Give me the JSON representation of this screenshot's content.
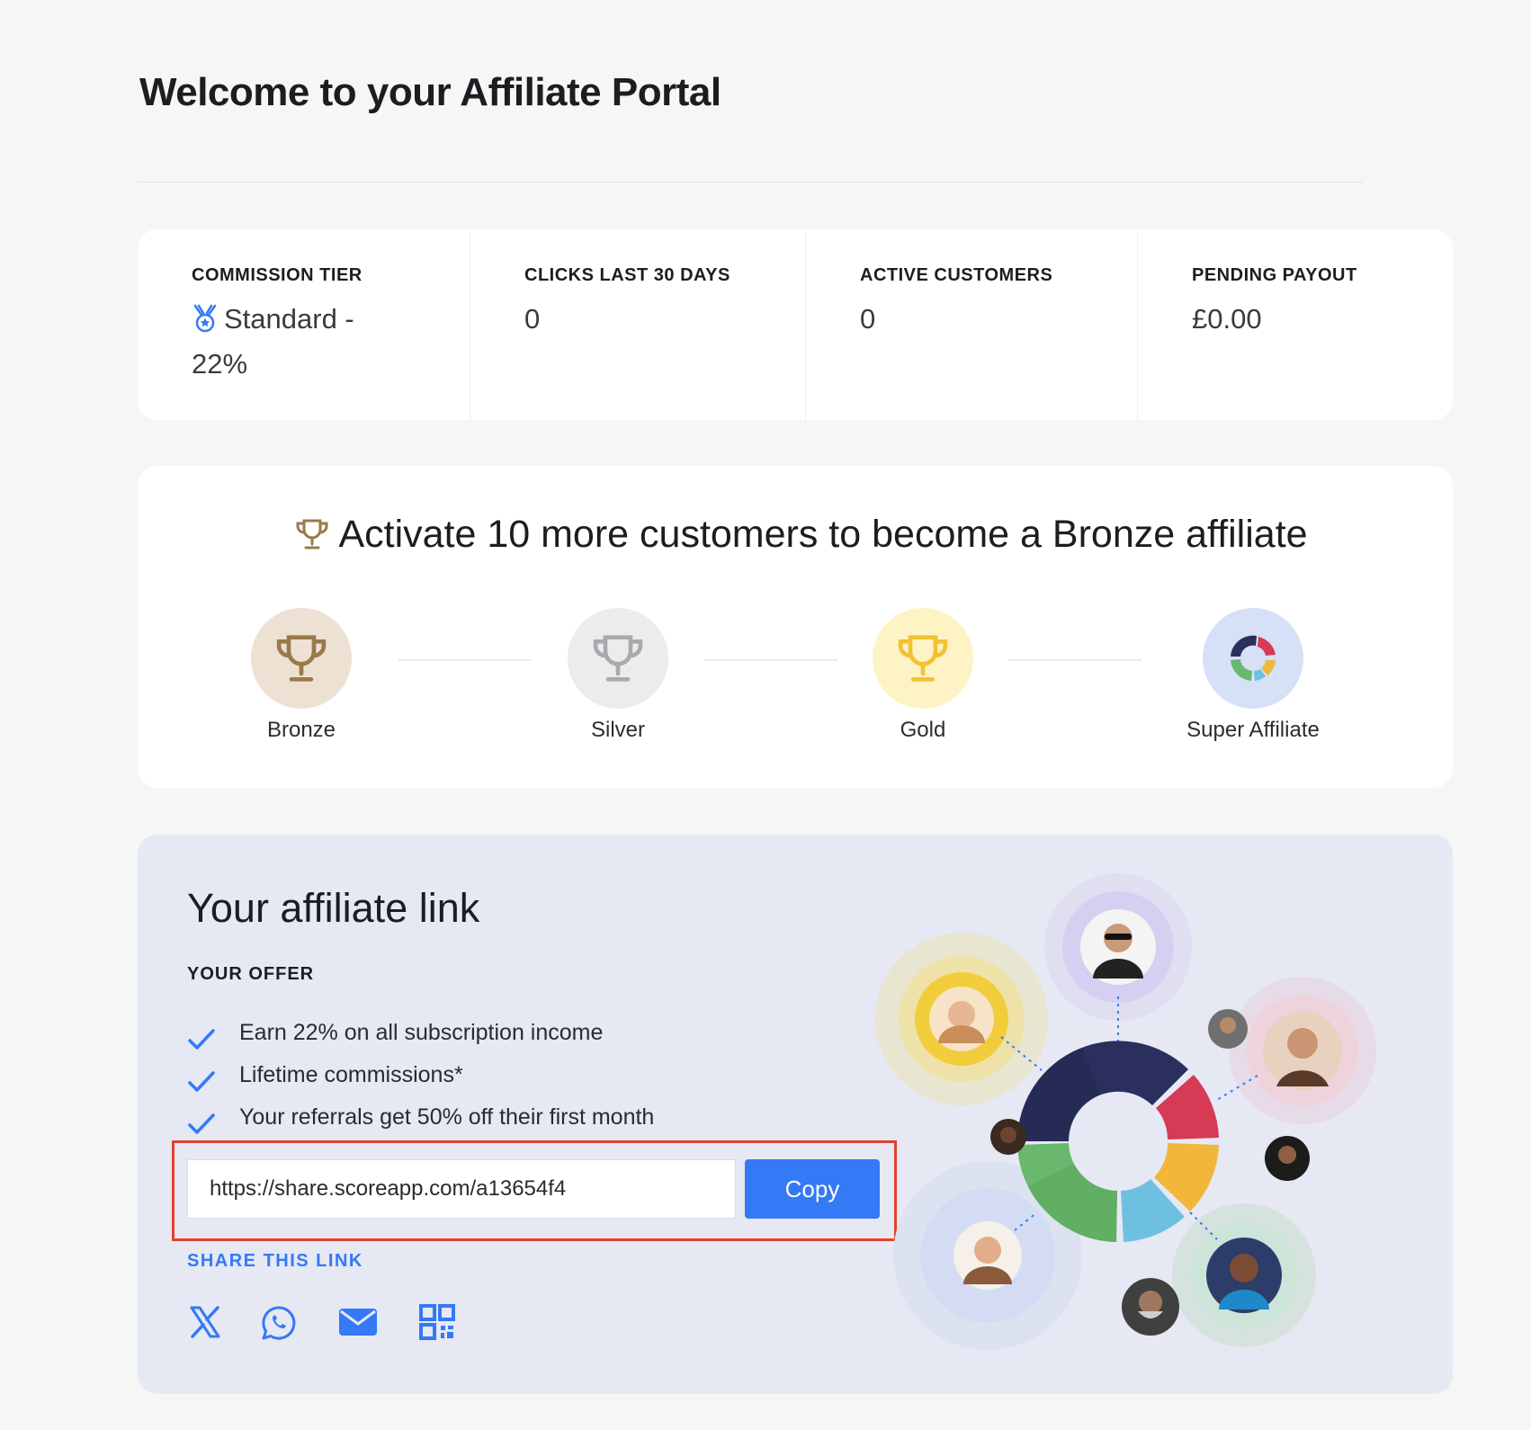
{
  "page": {
    "title": "Welcome to your Affiliate Portal"
  },
  "stats": [
    {
      "label": "COMMISSION TIER",
      "value_line1": "Standard -",
      "value_line2": "22%"
    },
    {
      "label": "CLICKS LAST 30 DAYS",
      "value": "0"
    },
    {
      "label": "ACTIVE CUSTOMERS",
      "value": "0"
    },
    {
      "label": "PENDING PAYOUT",
      "value": "£0.00"
    }
  ],
  "tier_progress": {
    "headline": "Activate 10 more customers to become a Bronze affiliate",
    "tiers": [
      {
        "label": "Bronze",
        "icon": "trophy-icon",
        "color": "#9a7a4b",
        "bg": "#ede1d3"
      },
      {
        "label": "Silver",
        "icon": "trophy-icon",
        "color": "#a9aaad",
        "bg": "#ececec"
      },
      {
        "label": "Gold",
        "icon": "trophy-icon",
        "color": "#f1c232",
        "bg": "#fdf3c4"
      },
      {
        "label": "Super Affiliate",
        "icon": "scoreapp-logo-icon",
        "bg": "#d6e1f7"
      }
    ]
  },
  "affiliate_link": {
    "title": "Your affiliate link",
    "offer_label": "YOUR OFFER",
    "offer_items": [
      "Earn 22% on all subscription income",
      "Lifetime commissions*",
      "Your referrals get 50% off their first month"
    ],
    "url": "https://share.scoreapp.com/a13654f4",
    "copy_label": "Copy",
    "share_label": "SHARE THIS LINK",
    "share_icons": [
      "x-icon",
      "whatsapp-icon",
      "email-icon",
      "qr-code-icon"
    ]
  },
  "colors": {
    "accent": "#3479f5",
    "highlight_border": "#e0422f",
    "card_bg": "#ffffff",
    "link_card_bg": "#e6e8f3"
  }
}
